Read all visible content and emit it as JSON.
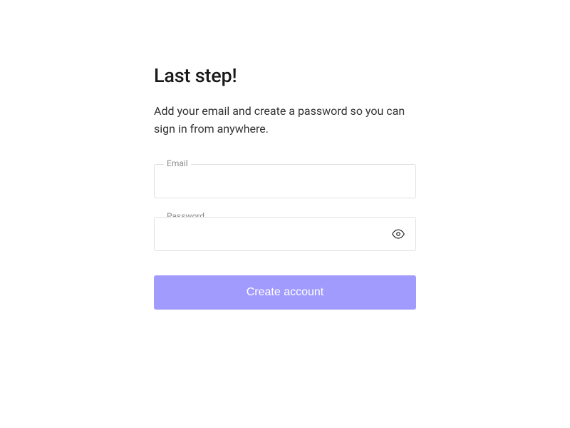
{
  "title": "Last step!",
  "subtitle": "Add your email and create a password so you can sign in from anywhere.",
  "fields": {
    "email": {
      "label": "Email",
      "value": ""
    },
    "password": {
      "label": "Password",
      "value": ""
    }
  },
  "submit_label": "Create account",
  "colors": {
    "accent": "#a29bfe"
  }
}
